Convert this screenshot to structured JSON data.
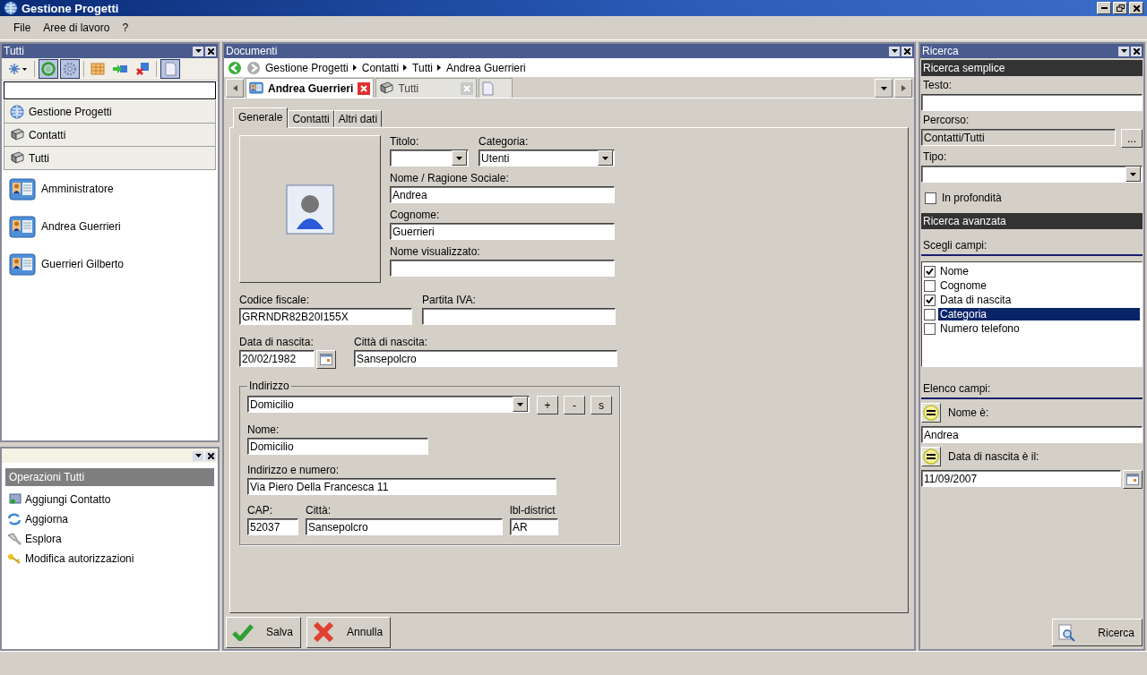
{
  "window": {
    "title": "Gestione Progetti"
  },
  "menu": [
    "File",
    "Aree di lavoro",
    "?"
  ],
  "explorer": {
    "title": "Tutti",
    "toolbar": [
      {
        "kind": "star",
        "on": false
      },
      {
        "kind": "refresh",
        "on": true
      },
      {
        "kind": "gear",
        "on": true
      },
      {
        "kind": "grid",
        "on": false
      },
      {
        "kind": "arrow",
        "on": false
      },
      {
        "kind": "remove",
        "on": false
      },
      {
        "kind": "page",
        "on": true
      }
    ],
    "nav": [
      {
        "kind": "globe",
        "label": "Gestione Progetti"
      },
      {
        "kind": "book",
        "label": "Contatti"
      },
      {
        "kind": "book",
        "label": "Tutti"
      }
    ],
    "contacts": [
      {
        "name": "Amministratore"
      },
      {
        "name": "Andrea Guerrieri"
      },
      {
        "name": "Guerrieri Gilberto"
      }
    ]
  },
  "tasks": {
    "header": "Operazioni Tutti",
    "items": [
      {
        "kind": "add",
        "label": "Aggiungi Contatto"
      },
      {
        "kind": "refresh",
        "label": "Aggiorna"
      },
      {
        "kind": "torch",
        "label": "Esplora"
      },
      {
        "kind": "key",
        "label": "Modifica autorizzazioni"
      }
    ]
  },
  "documents": {
    "title": "Documenti",
    "breadcrumb": [
      "Gestione Progetti",
      "Contatti",
      "Tutti",
      "Andrea Guerrieri"
    ],
    "tabs": [
      {
        "kind": "card",
        "label": "Andrea Guerrieri",
        "selected": true
      },
      {
        "kind": "book",
        "label": "Tutti",
        "selected": false
      },
      {
        "kind": "page",
        "selected": false
      }
    ],
    "form_tabs": [
      {
        "label": "Generale",
        "selected": true
      },
      {
        "label": "Contatti",
        "selected": false
      },
      {
        "label": "Altri dati",
        "selected": false
      }
    ],
    "form": {
      "titolo": {
        "label": "Titolo:"
      },
      "categoria": {
        "label": "Categoria:",
        "value": "Utenti"
      },
      "nome": {
        "label": "Nome / Ragione Sociale:",
        "value": "Andrea"
      },
      "cognome": {
        "label": "Cognome:",
        "value": "Guerrieri"
      },
      "nome_visualizzato": {
        "label": "Nome visualizzato:"
      },
      "codice_fiscale": {
        "label": "Codice fiscale:",
        "value": "GRRNDR82B20I155X"
      },
      "partita_iva": {
        "label": "Partita IVA:"
      },
      "data_nascita": {
        "label": "Data di nascita:",
        "value": "20/02/1982"
      },
      "citta_nascita": {
        "label": "Città di nascita:",
        "value": "Sansepolcro"
      }
    },
    "address": {
      "legend": "Indirizzo",
      "type": "Domicilio",
      "buttons": [
        "+",
        "-",
        "s"
      ],
      "nome": {
        "label": "Nome:",
        "value": "Domicilio"
      },
      "via": {
        "label": "Indirizzo e numero:",
        "value": "Via Piero Della Francesca 11"
      },
      "cap": {
        "label": "CAP:",
        "value": "52037"
      },
      "citta": {
        "label": "Città:",
        "value": "Sansepolcro"
      },
      "district": {
        "label": "lbl-district",
        "value": "AR"
      }
    },
    "actions": [
      {
        "kind": "ok",
        "label": "Salva"
      },
      {
        "kind": "cancel",
        "label": "Annulla"
      }
    ]
  },
  "search": {
    "title": "Ricerca",
    "simple_header": "Ricerca semplice",
    "testo": {
      "label": "Testo:"
    },
    "percorso": {
      "label": "Percorso:",
      "value": "Contatti/Tutti",
      "button": "..."
    },
    "tipo": {
      "label": "Tipo:"
    },
    "deep": {
      "label": "In profondità",
      "checked": false
    },
    "advanced_header": "Ricerca avanzata",
    "choose_label": "Scegli campi:",
    "fields": [
      {
        "label": "Nome",
        "checked": true,
        "selected": false
      },
      {
        "label": "Cognome",
        "checked": false,
        "selected": false
      },
      {
        "label": "Data di nascita",
        "checked": true,
        "selected": false
      },
      {
        "label": "Categoria",
        "checked": false,
        "selected": true
      },
      {
        "label": "Numero telefono",
        "checked": false,
        "selected": false
      }
    ],
    "list_label": "Elenco campi:",
    "conditions": [
      {
        "kind": "text",
        "label": "Nome è:",
        "value": "Andrea"
      },
      {
        "kind": "date",
        "label": "Data di nascita è il:",
        "value": "11/09/2007"
      }
    ],
    "button": "Ricerca"
  }
}
